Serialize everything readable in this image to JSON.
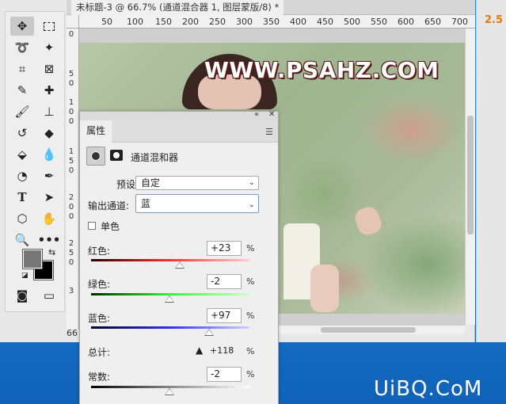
{
  "document_tab": {
    "title": "未标题-3 @ 66.7% (通道混合器 1, 图层蒙版/8) *"
  },
  "ruler": {
    "top_ticks": [
      "50",
      "100",
      "150",
      "200",
      "250",
      "300",
      "350",
      "400",
      "450",
      "500",
      "550",
      "600",
      "650",
      "700"
    ],
    "left_ticks": [
      "0",
      "5",
      "0",
      "1",
      "0",
      "0",
      "1",
      "5",
      "0",
      "2",
      "0",
      "0",
      "2",
      "5",
      "0",
      "3"
    ]
  },
  "status": {
    "zoom": "66"
  },
  "right_panel": {
    "value": "2.5"
  },
  "watermark": {
    "site": "WWW.PSAHZ.COM",
    "bottom": "UiBQ.CoM"
  },
  "properties": {
    "tab_label": "属性",
    "adjustment_name": "通道混和器",
    "preset": {
      "label": "预设:",
      "value": "自定"
    },
    "output_channel": {
      "label": "输出通道:",
      "value": "蓝"
    },
    "monochrome_label": "单色",
    "red": {
      "label": "红色:",
      "value": "+23",
      "unit": "%",
      "level": 23
    },
    "green": {
      "label": "绿色:",
      "value": "-2",
      "unit": "%",
      "level": -2
    },
    "blue": {
      "label": "蓝色:",
      "value": "+97",
      "unit": "%",
      "level": 97
    },
    "total": {
      "label": "总计:",
      "value": "+118",
      "unit": "%"
    },
    "constant": {
      "label": "常数:",
      "value": "-2",
      "unit": "%",
      "level": -2
    }
  },
  "colors": {
    "foreground": "#777777",
    "background": "#000000",
    "accent": "#e07a00"
  }
}
